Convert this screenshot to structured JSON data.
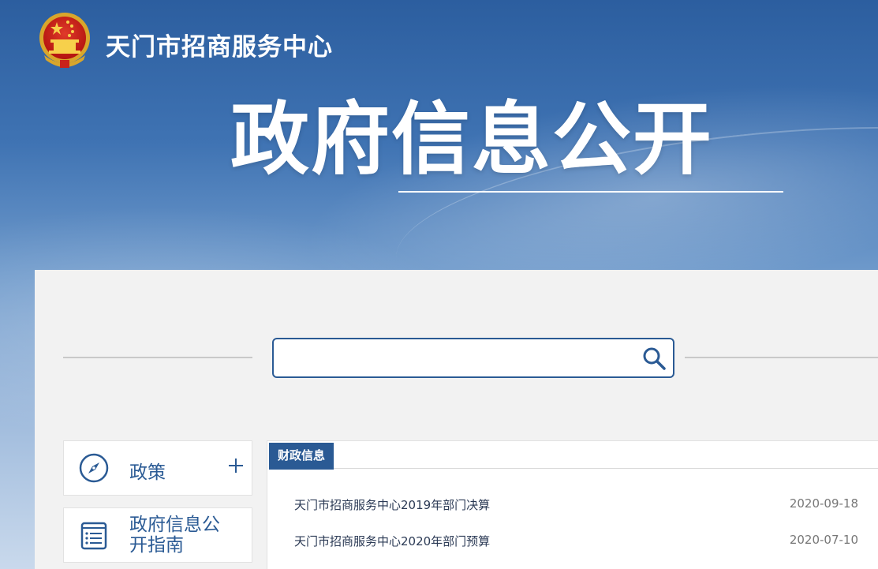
{
  "header": {
    "site_name": "天门市招商服务中心",
    "hero_title": "政府信息公开"
  },
  "search": {
    "placeholder": "",
    "value": ""
  },
  "sidebar": {
    "items": [
      {
        "label": "政策",
        "icon": "compass-icon",
        "expand": "plus-icon"
      },
      {
        "label": "政府信息公开指南",
        "icon": "document-list-icon"
      }
    ]
  },
  "content": {
    "tab_label": "财政信息",
    "rows": [
      {
        "title": "天门市招商服务中心2019年部门决算",
        "date": "2020-09-18"
      },
      {
        "title": "天门市招商服务中心2020年部门预算",
        "date": "2020-07-10"
      }
    ]
  },
  "colors": {
    "brand_blue": "#2a5a94",
    "banner_top": "#2c5e9f",
    "panel_bg": "#f2f2f2"
  }
}
